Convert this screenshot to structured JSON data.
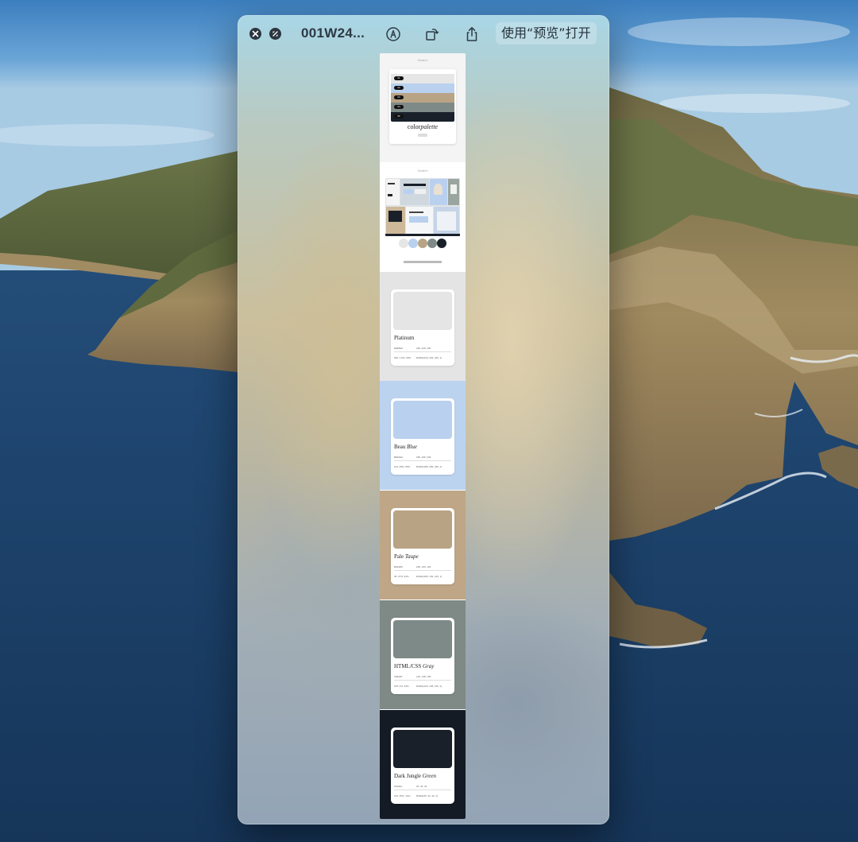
{
  "window": {
    "title": "001W24...",
    "open_with_label": "使用“预览”打开",
    "icons": {
      "close": "close-icon",
      "fullscreen": "fullscreen-icon",
      "markup": "markup-icon",
      "rotate": "rotate-icon",
      "share": "share-icon"
    }
  },
  "document": {
    "cover": {
      "header": "Swatch",
      "title_plain": "color",
      "title_italic": "palette",
      "stripes": [
        {
          "color": "#e6e6e6",
          "tag": "01"
        },
        {
          "color": "#b9d1ef",
          "tag": "02"
        },
        {
          "color": "#b9a385",
          "tag": "03"
        },
        {
          "color": "#7e8a87",
          "tag": "04"
        },
        {
          "color": "#19202a",
          "tag": "05"
        }
      ]
    },
    "mockups_page": {
      "header": "Swatch",
      "dot_colors": [
        "#e6e6e6",
        "#b9d1ef",
        "#b9a385",
        "#7e8a87",
        "#19202a"
      ]
    },
    "swatches": [
      {
        "page_bg": "#e4e4e4",
        "chip": "#e6e5e6",
        "name_plain": "Platinum",
        "name_italic": "",
        "hex": "E6E5E6",
        "rgb": "230, 229, 230",
        "hsl": "300, 1.5%, 90%",
        "rgba": "RGBA(230, 229, 230, 1)"
      },
      {
        "page_bg": "#bcd3ef",
        "chip": "#b9d1ef",
        "name_plain": "Beau",
        "name_italic": "Blue",
        "hex": "B9D1EF",
        "rgb": "185, 209, 239",
        "hsl": "213, 65%, 83%",
        "rgba": "RGBA(185, 209, 239, 1)"
      },
      {
        "page_bg": "#bea686",
        "chip": "#b9a385",
        "name_plain": "Pale",
        "name_italic": "Taupe",
        "hex": "B9A385",
        "rgb": "185, 163, 133",
        "hsl": "35, 27%, 62%",
        "rgba": "RGBA(185, 163, 133, 1)"
      },
      {
        "page_bg": "#7f8985",
        "chip": "#7e8a87",
        "name_plain": "HTML/CSS",
        "name_italic": "Gray",
        "hex": "7E8A87",
        "rgb": "126, 138, 135",
        "hsl": "165, 4%, 52%",
        "rgba": "RGBA(126, 138, 135, 1)"
      },
      {
        "page_bg": "#141b25",
        "chip": "#19202a",
        "name_plain": "Dark Jungle",
        "name_italic": "Green",
        "hex": "19202A",
        "rgb": "25, 32, 42",
        "hsl": "215, 25%, 13%",
        "rgba": "RGBA(25, 32, 42, 1)"
      }
    ]
  }
}
